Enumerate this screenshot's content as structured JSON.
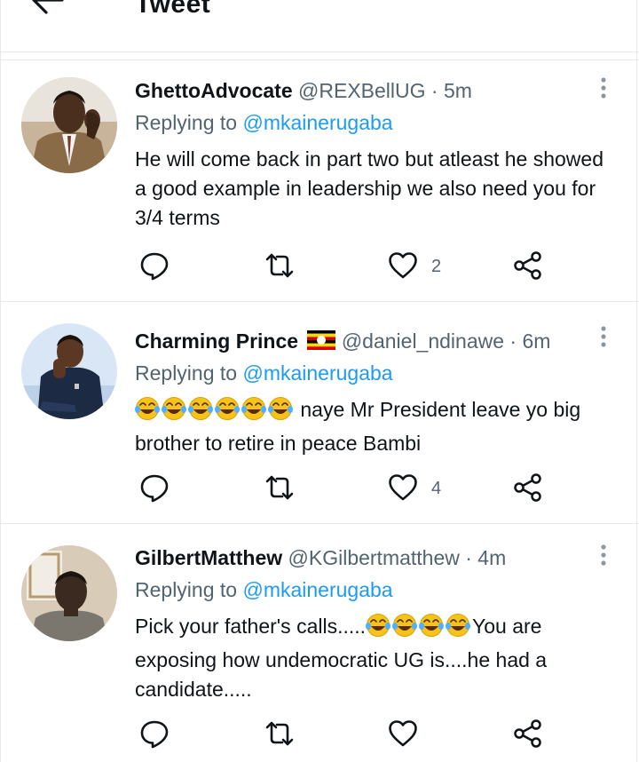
{
  "header": {
    "title": "Tweet"
  },
  "tweets": [
    {
      "name": "GhettoAdvocate",
      "meta": "@REXBellUG · 5m",
      "replying_prefix": "Replying to",
      "replying_to": "@mkainerugaba",
      "text": "He will come back in part two but atleast he showed a good example in leadership we also need you for 3/4 terms",
      "likes": "2"
    },
    {
      "name": "Charming Prince",
      "meta": "@daniel_ndinawe · 6m",
      "replying_prefix": "Replying to",
      "replying_to": "@mkainerugaba",
      "text_emojis": "😂😂😂😂😂😂",
      "text": " naye Mr President leave yo big brother to retire in peace Bambi",
      "likes": "4"
    },
    {
      "name": "GilbertMatthew",
      "meta": "@KGilbertmatthew · 4m",
      "replying_prefix": "Replying to",
      "replying_to": "@mkainerugaba",
      "text_before": "Pick your father's calls.....",
      "text_emojis": "😂😂😂😂",
      "text_after": "You are exposing how undemocratic UG is....he had a candidate.....",
      "likes": ""
    }
  ],
  "colors": {
    "accent": "#1d9bf0",
    "muted": "#536471",
    "text": "#0f1419",
    "laugh_emoji": "#f7c21a"
  }
}
